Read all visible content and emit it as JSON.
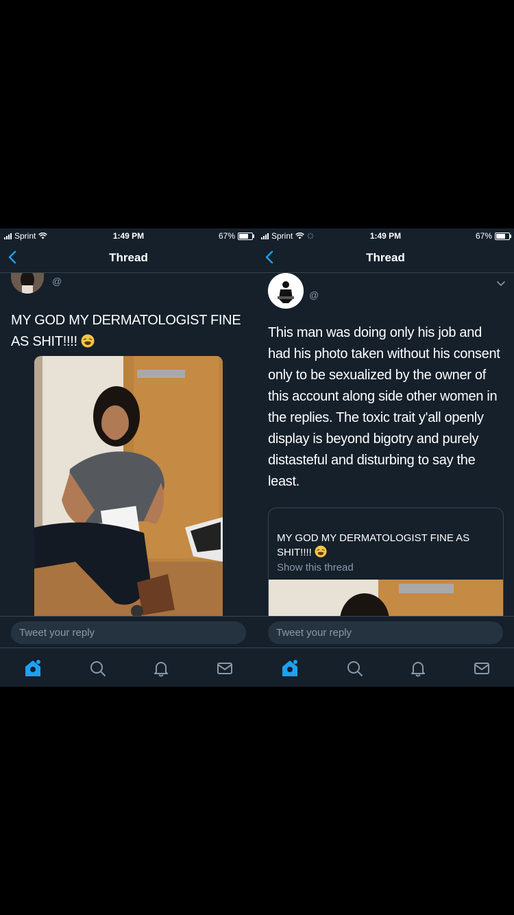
{
  "colors": {
    "background": "#000000",
    "screen_bg": "#15202b",
    "accent": "#1da1f2",
    "muted": "#8899a6",
    "divider": "#38444d"
  },
  "left": {
    "status": {
      "carrier": "Sprint",
      "time": "1:49 PM",
      "battery": "67%",
      "battery_level": 0.67
    },
    "nav": {
      "title": "Thread",
      "back_icon": "chevron-left-icon"
    },
    "tweet": {
      "handle": "@",
      "text": "MY GOD MY DERMATOLOGIST FINE AS SHIT!!!!",
      "emoji": "weary-face-emoji"
    },
    "reply": {
      "placeholder": "Tweet your reply"
    },
    "tabs": [
      "home-icon",
      "search-icon",
      "bell-icon",
      "mail-icon"
    ]
  },
  "right": {
    "status": {
      "carrier": "Sprint",
      "time": "1:49 PM",
      "battery": "67%",
      "battery_level": 0.67
    },
    "nav": {
      "title": "Thread",
      "back_icon": "chevron-left-icon"
    },
    "tweet": {
      "handle": "@",
      "text": "This man was doing only his job and had his photo taken without his consent only to be sexualized by the owner of this account along side other women in the replies. The toxic trait y'all openly display is beyond bigotry and purely distasteful and disturbing to say the least.",
      "quote": {
        "text": "MY GOD MY DERMATOLOGIST FINE AS SHIT!!!!",
        "show_thread": "Show this thread"
      }
    },
    "reply": {
      "placeholder": "Tweet your reply"
    },
    "tabs": [
      "home-icon",
      "search-icon",
      "bell-icon",
      "mail-icon"
    ]
  }
}
